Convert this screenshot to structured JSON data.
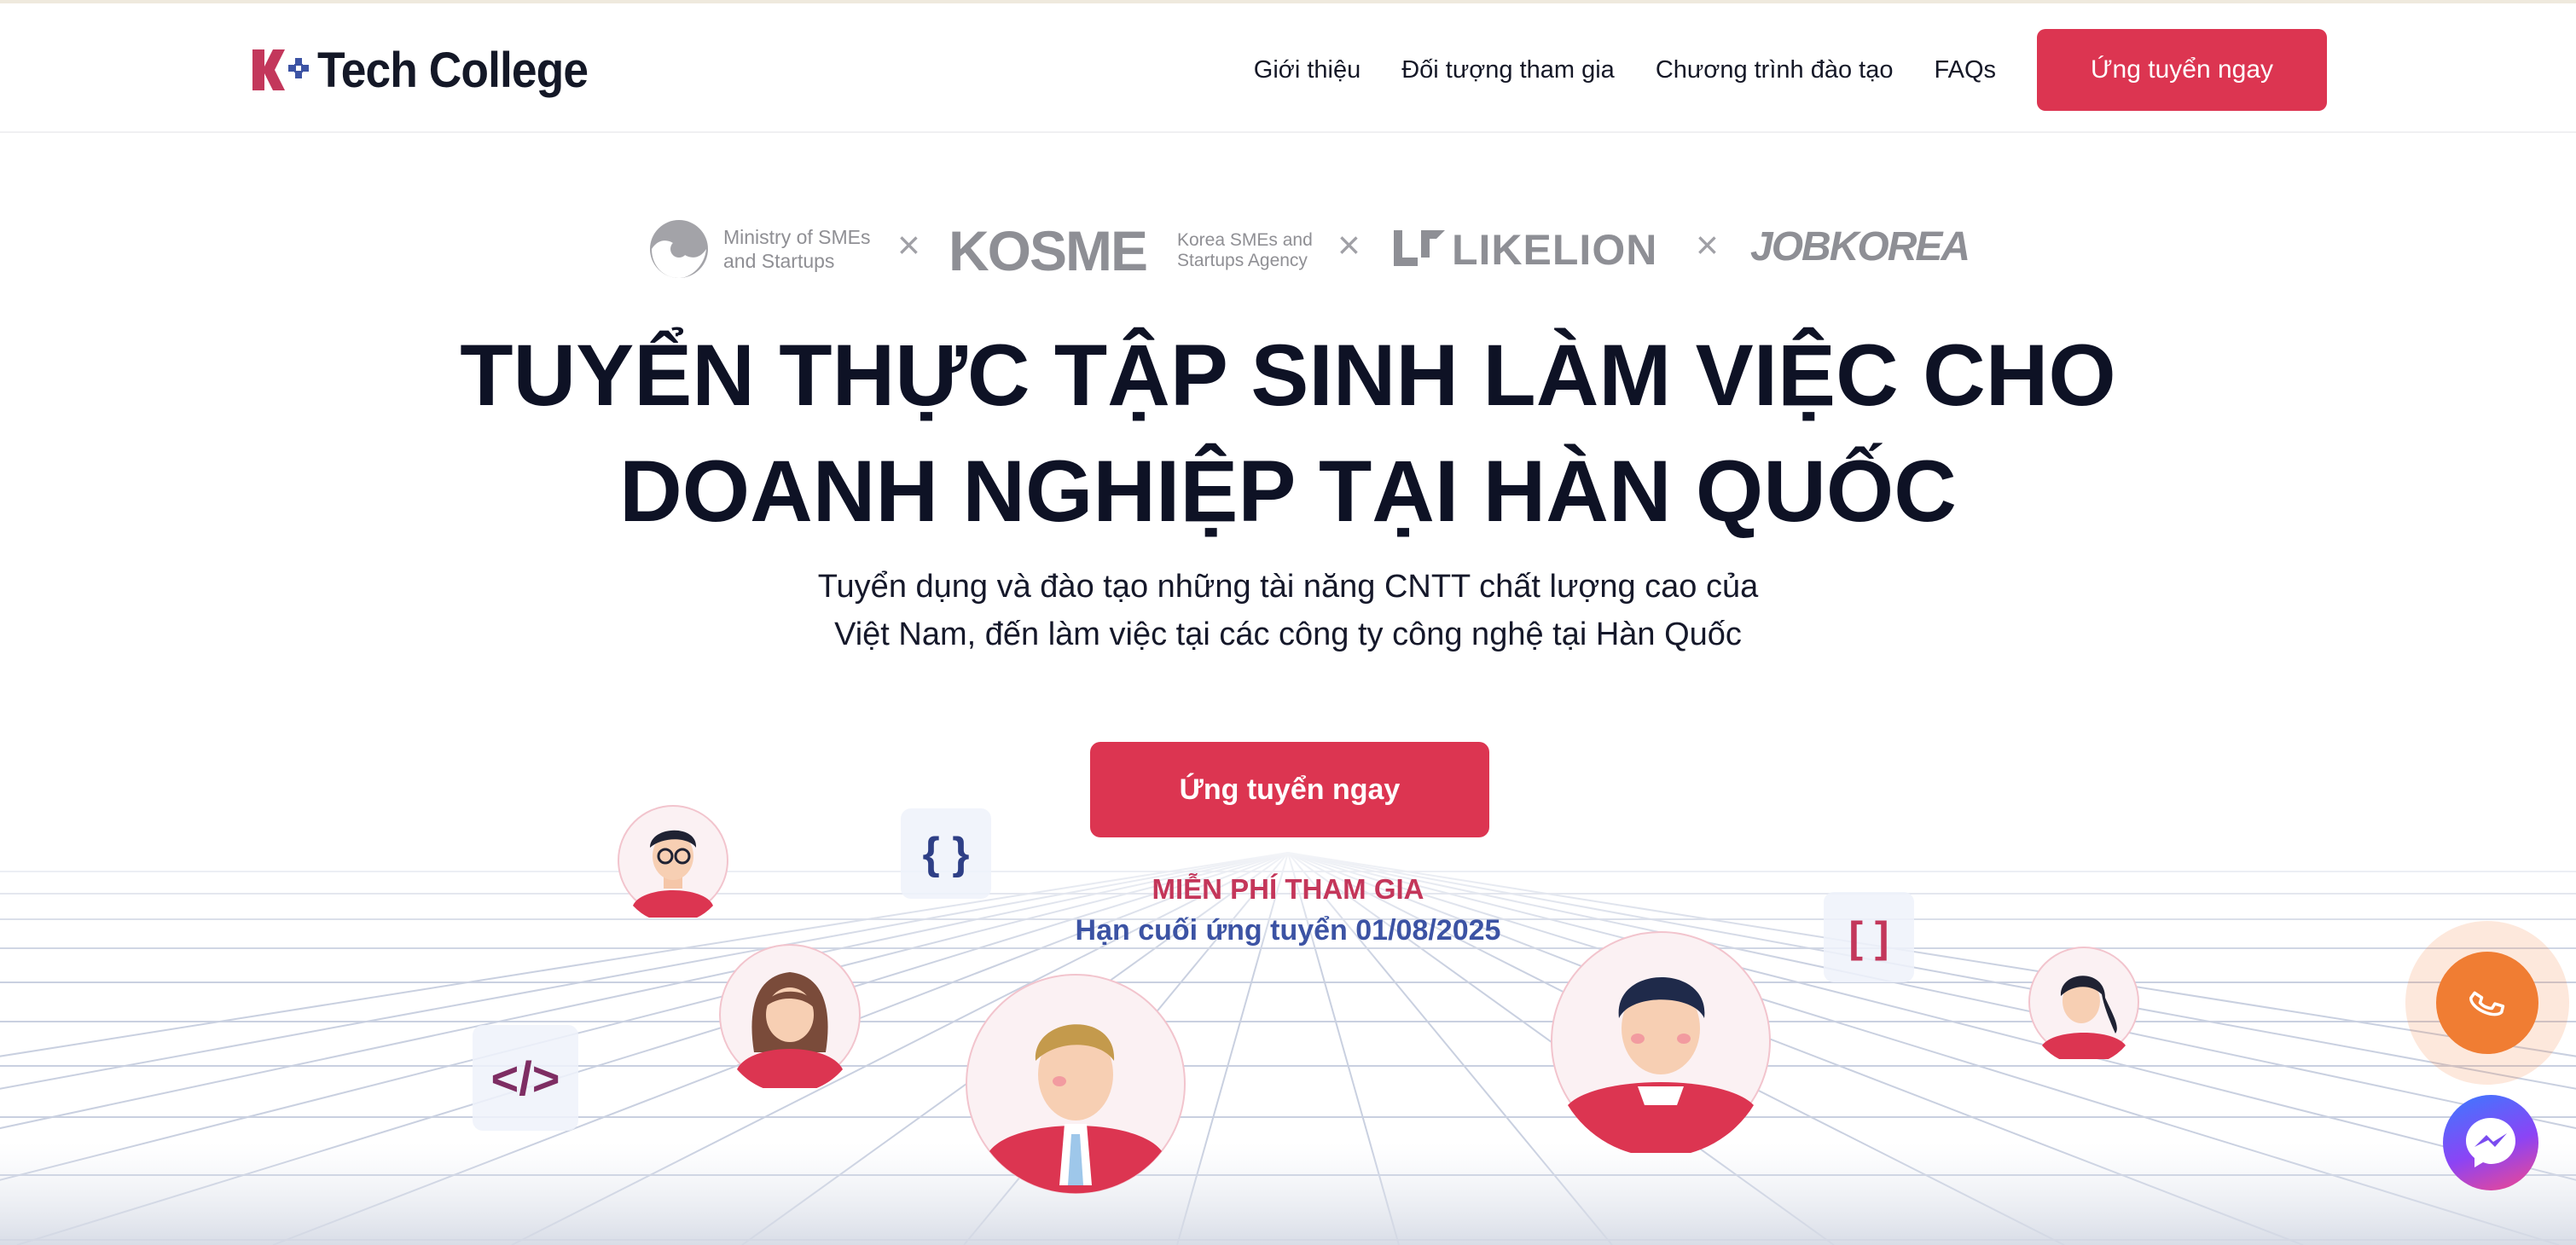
{
  "header": {
    "logo_text": "Tech College",
    "logo_letter": "K",
    "nav": [
      {
        "label": "Giới thiệu"
      },
      {
        "label": "Đối tượng tham gia"
      },
      {
        "label": "Chương trình đào tạo"
      },
      {
        "label": "FAQs"
      }
    ],
    "cta_label": "Ứng tuyển ngay"
  },
  "partners": {
    "ministry": "Ministry of SMEs and Startups",
    "ministry_line1": "Ministry of SMEs",
    "ministry_line2": "and Startups",
    "kosme": "KOSME",
    "kosme_sub_line1": "Korea SMEs and",
    "kosme_sub_line2": "Startups Agency",
    "likelion": "LIKELION",
    "jobkorea": "JOBKOREA",
    "separator": "×"
  },
  "hero": {
    "title_line1": "TUYỂN THỰC TẬP SINH LÀM VIỆC CHO",
    "title_line2": "DOANH NGHIỆP TẠI HÀN QUỐC",
    "subtitle_line1": "Tuyển dụng và đào tạo những tài năng CNTT chất lượng cao của",
    "subtitle_line2": "Việt Nam, đến làm việc tại các công ty công nghệ tại Hàn Quốc",
    "cta_label": "Ứng tuyển ngay",
    "free_label": "MIỄN PHÍ THAM GIA",
    "deadline_label": "Hạn cuối ứng tuyển 01/08/2025"
  },
  "decorations": {
    "braces": "{ }",
    "tag": "</>",
    "brackets": "[ ]"
  },
  "colors": {
    "brand_red": "#dc3551",
    "deadline_blue": "#3c53a4",
    "call_orange": "#f07d33"
  },
  "icons": [
    "phone-icon",
    "messenger-icon"
  ]
}
